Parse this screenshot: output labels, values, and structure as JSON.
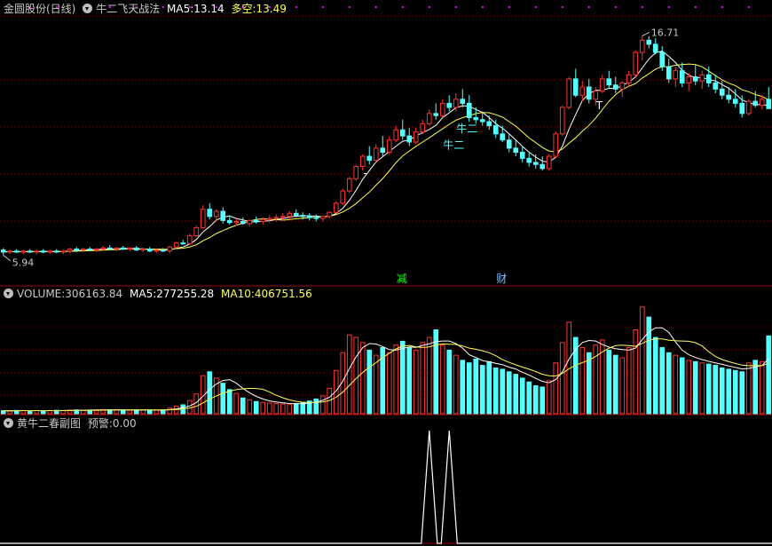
{
  "colors": {
    "up": "#ff3232",
    "down": "#54ffff",
    "ma5": "#ffffff",
    "ma10": "#ffff54",
    "grid": "#800000",
    "label_cyan": "#54ffff",
    "label_green": "#00ff00"
  },
  "header_main": {
    "title": "金圆股份(日线)",
    "indicator": "牛二飞天战法",
    "ma5_label": "MA5:",
    "ma5_value": "13.14",
    "duokong_label": "多空:",
    "duokong_value": "13.49"
  },
  "header_volume": {
    "label": "VOLUME:",
    "value": "306163.84",
    "ma5_label": "MA5:",
    "ma5_value": "277255.28",
    "ma10_label": "MA10:",
    "ma10_value": "406751.56"
  },
  "header_sub": {
    "indicator": "黄牛二春副图",
    "warn_label": "预警:",
    "warn_value": "0.00"
  },
  "chart_data": [
    {
      "type": "candlestick",
      "price_range": [
        5.4,
        17.6
      ],
      "high_label": "16.71",
      "low_label": "5.94",
      "annotations": [
        {
          "text": "牛二",
          "index": 67
        },
        {
          "text": "牛二",
          "index": 69
        },
        {
          "text": "T",
          "index": 90
        },
        {
          "text": "减",
          "index": 60
        },
        {
          "text": "财",
          "index": 75
        },
        {
          "text": "-",
          "index": 55
        }
      ],
      "ohlc": [
        [
          6.2,
          6.3,
          5.94,
          6.1
        ],
        [
          6.1,
          6.2,
          6.0,
          6.15
        ],
        [
          6.15,
          6.25,
          6.05,
          6.1
        ],
        [
          6.1,
          6.2,
          6.0,
          6.15
        ],
        [
          6.15,
          6.25,
          6.05,
          6.1
        ],
        [
          6.1,
          6.2,
          6.0,
          6.15
        ],
        [
          6.15,
          6.25,
          6.05,
          6.1
        ],
        [
          6.1,
          6.2,
          6.0,
          6.15
        ],
        [
          6.15,
          6.25,
          6.05,
          6.1
        ],
        [
          6.1,
          6.2,
          6.0,
          6.15
        ],
        [
          6.15,
          6.3,
          6.05,
          6.25
        ],
        [
          6.25,
          6.35,
          6.1,
          6.2
        ],
        [
          6.2,
          6.3,
          6.1,
          6.25
        ],
        [
          6.25,
          6.35,
          6.15,
          6.2
        ],
        [
          6.2,
          6.3,
          6.1,
          6.25
        ],
        [
          6.25,
          6.4,
          6.15,
          6.3
        ],
        [
          6.3,
          6.45,
          6.2,
          6.25
        ],
        [
          6.25,
          6.35,
          6.15,
          6.3
        ],
        [
          6.3,
          6.4,
          6.2,
          6.25
        ],
        [
          6.25,
          6.35,
          6.15,
          6.3
        ],
        [
          6.3,
          6.4,
          6.15,
          6.2
        ],
        [
          6.2,
          6.3,
          6.1,
          6.25
        ],
        [
          6.25,
          6.35,
          6.1,
          6.15
        ],
        [
          6.15,
          6.25,
          6.05,
          6.2
        ],
        [
          6.2,
          6.3,
          6.1,
          6.15
        ],
        [
          6.15,
          6.4,
          6.05,
          6.35
        ],
        [
          6.35,
          6.6,
          6.3,
          6.55
        ],
        [
          6.55,
          6.7,
          6.45,
          6.5
        ],
        [
          6.5,
          7.0,
          6.45,
          6.9
        ],
        [
          6.9,
          7.4,
          6.85,
          7.3
        ],
        [
          7.3,
          8.4,
          7.25,
          8.2
        ],
        [
          8.2,
          8.5,
          7.7,
          7.85
        ],
        [
          7.85,
          8.2,
          7.6,
          8.1
        ],
        [
          8.1,
          8.3,
          7.5,
          7.65
        ],
        [
          7.65,
          7.9,
          7.45,
          7.55
        ],
        [
          7.55,
          7.75,
          7.4,
          7.6
        ],
        [
          7.6,
          7.8,
          7.45,
          7.5
        ],
        [
          7.5,
          7.7,
          7.35,
          7.65
        ],
        [
          7.65,
          7.85,
          7.5,
          7.6
        ],
        [
          7.6,
          7.8,
          7.45,
          7.7
        ],
        [
          7.7,
          7.9,
          7.55,
          7.75
        ],
        [
          7.75,
          7.95,
          7.6,
          7.8
        ],
        [
          7.8,
          8.0,
          7.65,
          7.85
        ],
        [
          7.85,
          8.1,
          7.7,
          8.0
        ],
        [
          8.0,
          8.2,
          7.8,
          7.9
        ],
        [
          7.9,
          8.05,
          7.7,
          7.85
        ],
        [
          7.85,
          8.0,
          7.65,
          7.8
        ],
        [
          7.8,
          7.95,
          7.6,
          7.75
        ],
        [
          7.75,
          7.9,
          7.6,
          7.85
        ],
        [
          7.85,
          8.1,
          7.75,
          8.05
        ],
        [
          8.05,
          8.6,
          8.0,
          8.5
        ],
        [
          8.5,
          9.2,
          8.4,
          9.1
        ],
        [
          9.1,
          9.8,
          9.0,
          9.7
        ],
        [
          9.7,
          10.4,
          9.6,
          10.3
        ],
        [
          10.3,
          10.9,
          10.1,
          10.8
        ],
        [
          10.8,
          11.3,
          10.4,
          10.6
        ],
        [
          10.6,
          11.4,
          10.5,
          11.2
        ],
        [
          11.2,
          11.8,
          10.8,
          11.0
        ],
        [
          11.0,
          11.8,
          10.9,
          11.6
        ],
        [
          11.6,
          12.3,
          11.5,
          12.1
        ],
        [
          12.1,
          12.6,
          11.6,
          11.8
        ],
        [
          11.8,
          12.2,
          11.3,
          11.5
        ],
        [
          11.5,
          12.2,
          11.4,
          12.0
        ],
        [
          12.0,
          12.6,
          11.9,
          12.4
        ],
        [
          12.4,
          13.1,
          12.3,
          12.9
        ],
        [
          12.9,
          13.4,
          12.6,
          12.8
        ],
        [
          12.8,
          13.6,
          12.7,
          13.4
        ],
        [
          13.4,
          13.8,
          13.0,
          13.2
        ],
        [
          13.2,
          13.9,
          13.0,
          13.6
        ],
        [
          13.6,
          14.1,
          13.2,
          13.4
        ],
        [
          13.4,
          13.8,
          12.5,
          12.7
        ],
        [
          12.7,
          13.2,
          12.4,
          12.6
        ],
        [
          12.6,
          13.0,
          12.3,
          12.5
        ],
        [
          12.5,
          12.8,
          12.1,
          12.3
        ],
        [
          12.3,
          12.6,
          11.7,
          11.9
        ],
        [
          11.9,
          12.3,
          11.5,
          11.6
        ],
        [
          11.6,
          11.9,
          11.0,
          11.2
        ],
        [
          11.2,
          11.6,
          10.8,
          11.0
        ],
        [
          11.0,
          11.3,
          10.5,
          10.7
        ],
        [
          10.7,
          11.0,
          10.3,
          10.5
        ],
        [
          10.5,
          10.9,
          10.2,
          10.4
        ],
        [
          10.4,
          10.8,
          10.1,
          10.2
        ],
        [
          10.2,
          10.9,
          10.1,
          10.8
        ],
        [
          10.8,
          12.0,
          10.7,
          11.9
        ],
        [
          11.9,
          13.3,
          11.8,
          13.2
        ],
        [
          13.2,
          14.7,
          13.1,
          14.6
        ],
        [
          14.6,
          15.1,
          13.7,
          13.8
        ],
        [
          13.8,
          14.5,
          13.5,
          14.2
        ],
        [
          14.2,
          14.6,
          13.4,
          13.6
        ],
        [
          13.6,
          14.2,
          13.3,
          14.0
        ],
        [
          14.0,
          14.8,
          13.9,
          14.6
        ],
        [
          14.6,
          15.0,
          14.1,
          14.3
        ],
        [
          14.3,
          14.7,
          13.9,
          14.1
        ],
        [
          14.1,
          14.5,
          13.7,
          14.4
        ],
        [
          14.4,
          15.0,
          14.2,
          14.8
        ],
        [
          14.8,
          16.0,
          14.7,
          15.9
        ],
        [
          15.9,
          16.71,
          15.5,
          16.5
        ],
        [
          16.5,
          16.7,
          16.1,
          16.3
        ],
        [
          16.3,
          16.6,
          15.8,
          15.9
        ],
        [
          15.9,
          16.2,
          15.0,
          15.2
        ],
        [
          15.2,
          15.6,
          14.4,
          14.6
        ],
        [
          14.6,
          15.2,
          14.2,
          15.0
        ],
        [
          15.0,
          15.4,
          14.2,
          14.4
        ],
        [
          14.4,
          14.9,
          14.0,
          14.7
        ],
        [
          14.7,
          15.3,
          14.3,
          14.5
        ],
        [
          14.5,
          15.0,
          14.1,
          14.8
        ],
        [
          14.8,
          15.2,
          14.2,
          14.4
        ],
        [
          14.4,
          14.8,
          13.9,
          14.1
        ],
        [
          14.1,
          14.5,
          13.6,
          13.8
        ],
        [
          13.8,
          14.2,
          13.4,
          13.6
        ],
        [
          13.6,
          14.1,
          13.2,
          13.4
        ],
        [
          13.4,
          13.8,
          12.7,
          12.9
        ],
        [
          12.9,
          13.6,
          12.8,
          13.5
        ],
        [
          13.5,
          14.0,
          13.2,
          13.3
        ],
        [
          13.3,
          13.8,
          13.1,
          13.6
        ],
        [
          13.6,
          14.2,
          13.4,
          13.14
        ]
      ]
    },
    {
      "type": "bar",
      "name": "VOLUME",
      "ylim": [
        0,
        440000
      ],
      "values": [
        12000,
        11000,
        13000,
        12500,
        11800,
        12200,
        11500,
        12800,
        13500,
        12000,
        14000,
        15000,
        13800,
        14500,
        15200,
        16000,
        15500,
        14800,
        15000,
        14200,
        13900,
        14600,
        13500,
        14000,
        15500,
        22000,
        30000,
        35000,
        52000,
        78000,
        150000,
        165000,
        140000,
        120000,
        95000,
        80000,
        62000,
        55000,
        48000,
        45000,
        42000,
        40000,
        38000,
        36000,
        40000,
        45000,
        50000,
        58000,
        70000,
        100000,
        170000,
        240000,
        310000,
        300000,
        280000,
        250000,
        230000,
        260000,
        240000,
        270000,
        285000,
        260000,
        250000,
        280000,
        300000,
        330000,
        270000,
        250000,
        230000,
        210000,
        200000,
        215000,
        190000,
        205000,
        180000,
        175000,
        165000,
        155000,
        140000,
        125000,
        110000,
        105000,
        130000,
        200000,
        280000,
        360000,
        300000,
        260000,
        240000,
        270000,
        290000,
        250000,
        230000,
        220000,
        260000,
        330000,
        420000,
        380000,
        300000,
        260000,
        240000,
        230000,
        220000,
        210000,
        205000,
        200000,
        195000,
        190000,
        180000,
        175000,
        170000,
        165000,
        200000,
        210000,
        205000,
        306164
      ]
    },
    {
      "type": "line",
      "name": "预警",
      "ylim": [
        0,
        1
      ],
      "spikes_at": [
        64,
        67
      ]
    }
  ]
}
